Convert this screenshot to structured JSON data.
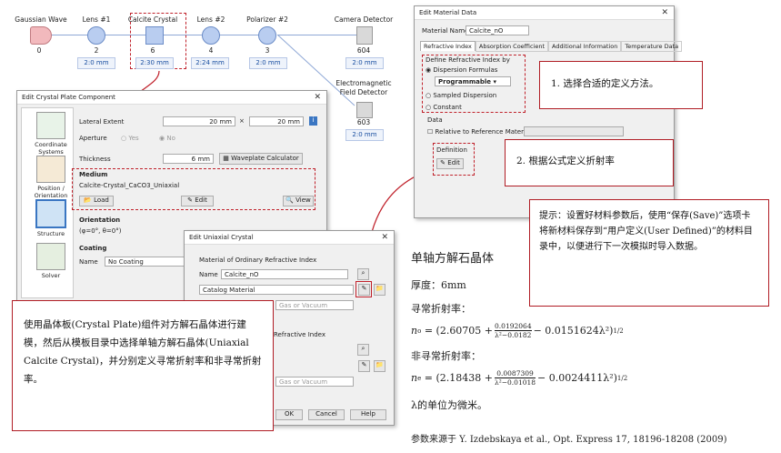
{
  "system": {
    "nodes": [
      {
        "label": "Gaussian Wave",
        "index": "0"
      },
      {
        "label": "Lens #1",
        "index": "2",
        "chip": "2:0 mm"
      },
      {
        "label": "Calcite Crystal",
        "index": "6",
        "chip": "2:30 mm"
      },
      {
        "label": "Lens #2",
        "index": "4",
        "chip": "2:24 mm"
      },
      {
        "label": "Polarizer #2",
        "index": "3",
        "chip": "2:0 mm"
      },
      {
        "label": "Camera Detector",
        "index": "604",
        "chip": "2:0 mm"
      },
      {
        "label": "Electromagnetic Field Detector",
        "index": "603",
        "chip": "2:0 mm"
      }
    ]
  },
  "crystal_dialog": {
    "title": "Edit Crystal Plate Component",
    "sidebar": [
      "Coordinate Systems",
      "Position / Orientation",
      "Structure",
      "Solver"
    ],
    "lateral_extent_label": "Lateral Extent",
    "lateral_x": "20 mm",
    "lateral_sep": "×",
    "lateral_y": "20 mm",
    "aperture_label": "Aperture",
    "aperture_yes": "Yes",
    "aperture_no": "No",
    "thickness_label": "Thickness",
    "thickness_value": "6 mm",
    "waveplate_button": "Waveplate Calculator",
    "medium_label": "Medium",
    "medium_value": "Calcite-Crystal_CaCO3_Uniaxial",
    "load_button": "Load",
    "edit_button": "Edit",
    "view_button": "View",
    "orientation_label": "Orientation",
    "orientation_value": "(φ=0°, θ=0°)",
    "coating_label": "Coating",
    "name_label": "Name",
    "coating_value": "No Coating"
  },
  "uniaxial_dialog": {
    "title": "Edit Uniaxial Crystal",
    "ordinary_section": "Material of Ordinary Refractive Index",
    "name_label": "Name",
    "name_value": "Calcite_nO",
    "catalog_value": "Catalog Material",
    "embed_value": "Gas or Vacuum",
    "extra_section": "Refractive Index",
    "embed_value2": "Gas or Vacuum",
    "ok": "OK",
    "cancel": "Cancel",
    "help": "Help"
  },
  "material_dialog": {
    "title": "Edit Material Data",
    "name_label": "Material Name",
    "name_value": "Calcite_nO",
    "tabs": [
      "Refractive Index",
      "Absorption Coefficient",
      "Additional Information",
      "Temperature Data"
    ],
    "define_label": "Define Refractive Index by",
    "opt_formulas": "Dispersion Formulas",
    "programmable": "Programmable",
    "opt_sampled": "Sampled Dispersion",
    "opt_constant": "Constant",
    "data_label": "Data",
    "relative_label": "Relative to Reference Material",
    "definition_label": "Definition",
    "edit_button": "Edit"
  },
  "callouts": {
    "step1": "1. 选择合适的定义方法。",
    "step2": "2. 根据公式定义折射率",
    "tip": "提示：设置好材料参数后，使用“保存(Save)”选项卡将新材料保存到“用户定义(User Defined)”的材料目录中，以便进行下一次模拟时导入数据。",
    "intro": "使用晶体板(Crystal Plate)组件对方解石晶体进行建模，然后从模板目录中选择单轴方解石晶体(Uniaxial Calcite Crystal)，并分别定义寻常折射率和非寻常折射率。"
  },
  "info": {
    "heading": "单轴方解石晶体",
    "thickness": "厚度：6mm",
    "ordinary_label": "寻常折射率：",
    "no_lhs": "n",
    "no_sub": "o",
    "no_rhs": "= (2.60705 + ",
    "no_num": "0.0192064",
    "no_den": "λ²−0.0182",
    "no_tail": " − 0.0151624λ²)",
    "exp": "1/2",
    "extra_label": "非寻常折射率：",
    "ne_lhs": "n",
    "ne_sub": "e",
    "ne_rhs": "= (2.18438 + ",
    "ne_num": "0.0087309",
    "ne_den": "λ²−0.01018",
    "ne_tail": " − 0.0024411λ²)",
    "unit_note": "λ的单位为微米。",
    "source": "参数来源于 Y. Izdebskaya et al., Opt. Express 17, 18196-18208 (2009)"
  },
  "colors": {
    "accent": "#b01c24",
    "node": "#b9cdf0",
    "chip_text": "#1a4fa0"
  }
}
